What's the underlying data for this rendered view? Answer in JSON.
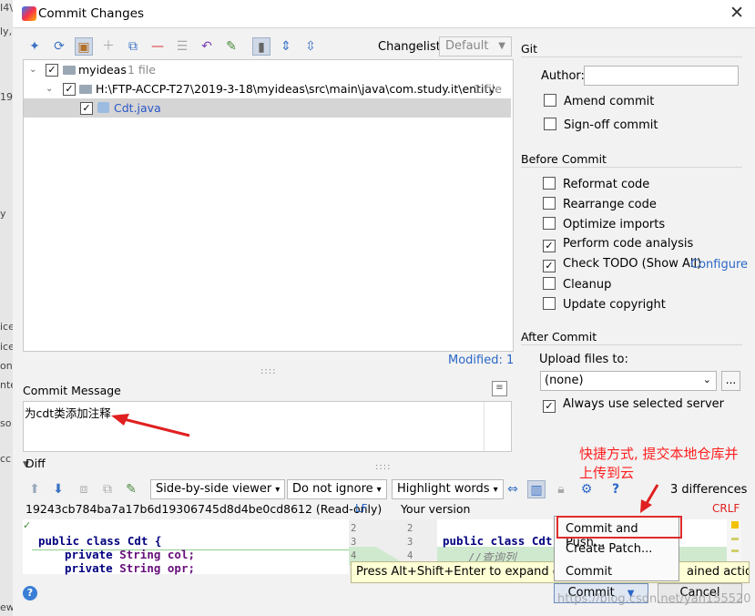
{
  "window": {
    "title": "Commit Changes",
    "close_glyph": "✕"
  },
  "left_bleed": [
    "I4\\r",
    "ly,",
    "19",
    "y",
    "ice",
    "ice",
    "ont",
    "nter",
    "so",
    "cc",
    "ew"
  ],
  "toolbar": {
    "icons": [
      "compare-icon",
      "refresh-icon",
      "shelve-icon",
      "add-icon",
      "move-icon",
      "remove-icon",
      "group-icon",
      "revert-icon",
      "jump-icon",
      "toggle-icon",
      "expand-icon",
      "collapse-icon"
    ],
    "changelist_label": "Changelist:",
    "changelist_value": "Default"
  },
  "tree": {
    "root": {
      "label": "myideas",
      "count": "1 file"
    },
    "dir": {
      "label": "H:\\FTP-ACCP-T27\\2019-3-18\\myideas\\src\\main\\java\\com.study.it\\entity",
      "count": "1 file"
    },
    "file": {
      "label": "Cdt.java"
    }
  },
  "modified_label": "Modified: 1",
  "commit_message": {
    "label": "Commit Message",
    "text": "为cdt类添加注释"
  },
  "git": {
    "section": "Git",
    "author_label": "Author:",
    "author_value": "",
    "amend_commit": "Amend commit",
    "signoff_commit": "Sign-off commit"
  },
  "before_commit": {
    "section": "Before Commit",
    "reformat": "Reformat code",
    "rearrange": "Rearrange code",
    "optimize": "Optimize imports",
    "perform": "Perform code analysis",
    "check_todo": "Check TODO (Show All)",
    "configure": "Configure",
    "cleanup": "Cleanup",
    "update_copyright": "Update copyright"
  },
  "after_commit": {
    "section": "After Commit",
    "upload_label": "Upload files to:",
    "upload_value": "(none)",
    "dots": "...",
    "always_use": "Always use selected server"
  },
  "diff": {
    "label": "Diff",
    "viewer": "Side-by-side viewer",
    "ignore": "Do not ignore",
    "highlight": "Highlight words",
    "differences": "3 differences",
    "left_header": "19243cb784ba7a17b6d19306745d8d4be0cd8612 (Read-only)",
    "left_le": "LF",
    "right_header": "Your version",
    "right_le": "CRLF",
    "left_lines": {
      "n2": "2",
      "n3": "3",
      "n4": "4"
    },
    "right_lines": {
      "n2": "2",
      "n3": "3",
      "n4": "4"
    },
    "code_left_1": "public class Cdt {",
    "code_left_2_kw": "private",
    "code_left_2_rest": " String col;",
    "code_left_3_kw": "private",
    "code_left_3_rest": " String opr;",
    "code_right_1": "public class Cdt {",
    "code_right_comment": "//查询列"
  },
  "tooltip": {
    "text": "Press Alt+Shift+Enter to expand or use",
    "tail": "ained action"
  },
  "commit_menu": {
    "commit_and_push": "Commit and Push...",
    "create_patch": "Create Patch...",
    "commit": "Commit"
  },
  "annotation": {
    "line1": "快捷方式, 提交本地仓库并",
    "line2": "上传到云"
  },
  "buttons": {
    "commit": "Commit",
    "cancel": "Cancel",
    "help": "?"
  },
  "watermark": "https://blog.csdn.net/yan155520"
}
